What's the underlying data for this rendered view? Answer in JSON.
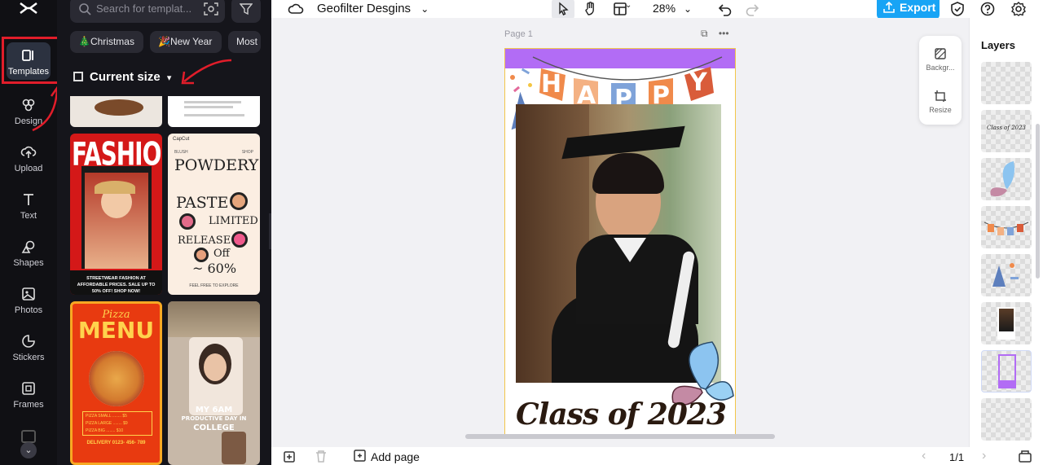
{
  "app": {
    "logo": "capcut-logo"
  },
  "rail": {
    "items": [
      {
        "label": "Templates",
        "icon": "templates-icon"
      },
      {
        "label": "Design",
        "icon": "design-icon"
      },
      {
        "label": "Upload",
        "icon": "upload-icon"
      },
      {
        "label": "Text",
        "icon": "text-icon"
      },
      {
        "label": "Shapes",
        "icon": "shapes-icon"
      },
      {
        "label": "Photos",
        "icon": "photos-icon"
      },
      {
        "label": "Stickers",
        "icon": "stickers-icon"
      },
      {
        "label": "Frames",
        "icon": "frames-icon"
      }
    ],
    "active": "Templates"
  },
  "panel": {
    "search_placeholder": "Search for templat...",
    "chips": [
      "🎄Christmas",
      "🎉New Year",
      "Most"
    ],
    "size_label": "Current size",
    "templates": {
      "fashion": {
        "title": "FASHION",
        "caption": "STREETWEAR FASHION AT AFFORDABLE PRICES. SALE UP TO 50% OFF! SHOP NOW!"
      },
      "powdery": {
        "brand": "CapCut",
        "left_tag": "BLUSH",
        "right_tag": "SHOP",
        "line1": "POWDERY",
        "line2": "PASTE",
        "line3": "LIMITED",
        "line4": "RELEASE",
        "line5": "Off",
        "line6": "~ 60%",
        "footer": "FEEL FREE TO EXPLORE"
      },
      "pizza": {
        "script": "Pizza",
        "title": "MENU",
        "items": [
          "PIZZA SMALL ........ $5",
          "PIZZA LARGE ........ $9",
          "PIZZA BIG ........ $10"
        ],
        "delivery": "DELIVERY 0123- 456- 789"
      },
      "vlog": {
        "line1": "MY 6AM",
        "line2": "PRODUCTIVE DAY IN",
        "line3": "COLLEGE"
      }
    }
  },
  "topbar": {
    "project_title": "Geofilter Desgins",
    "zoom": "28%",
    "export_label": "Export"
  },
  "canvas": {
    "page_label": "Page 1",
    "banner_letters": [
      "H",
      "A",
      "P",
      "P",
      "Y"
    ],
    "headline": "Class of 2023",
    "float_tools": [
      {
        "label": "Backgr...",
        "icon": "background-icon"
      },
      {
        "label": "Resize",
        "icon": "resize-icon"
      }
    ]
  },
  "layers": {
    "title": "Layers",
    "items": [
      "layer-blank",
      "layer-class-of-2023-text",
      "layer-butterfly",
      "layer-happy-banner",
      "layer-confetti",
      "layer-photo",
      "layer-purple-frame",
      "layer-blank-2"
    ],
    "thumb_text": "Class of 2023"
  },
  "bottombar": {
    "add_page_label": "Add page",
    "pager": "1/1"
  },
  "colors": {
    "accent": "#18a4f5",
    "highlight": "#e11d2a",
    "banner_purple": "#b26cf5"
  }
}
